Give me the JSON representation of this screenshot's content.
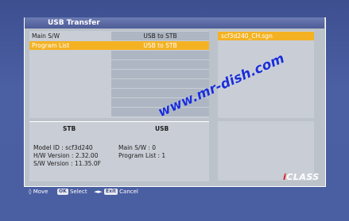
{
  "window": {
    "title": "USB Transfer"
  },
  "list": {
    "rows": [
      {
        "name": "Main S/W",
        "action": "USB to STB"
      },
      {
        "name": "Program List",
        "action": "USB to STB"
      }
    ]
  },
  "files": {
    "items": [
      "scf3d240_CH.sgn"
    ]
  },
  "info": {
    "stb_header": "STB",
    "usb_header": "USB",
    "model_id": "Model ID : scf3d240",
    "hw_version": "H/W Version : 2.32.00",
    "sw_version": "S/W Version : 11.35.0F",
    "usb_main_sw": "Main S/W : 0",
    "usb_program_list": "Program List : 1"
  },
  "footer": {
    "move_label": "Move",
    "ok_key": "OK",
    "select_label": "Select",
    "exit_key": "Exit",
    "cancel_label": "Cancel"
  },
  "watermark": "www.mr-dish.com",
  "brand": {
    "prefix": "i",
    "rest": "CLASS"
  },
  "colors": {
    "selection": "#f4b223",
    "background": "#4b5fa3",
    "panel": "#c9ced6"
  }
}
